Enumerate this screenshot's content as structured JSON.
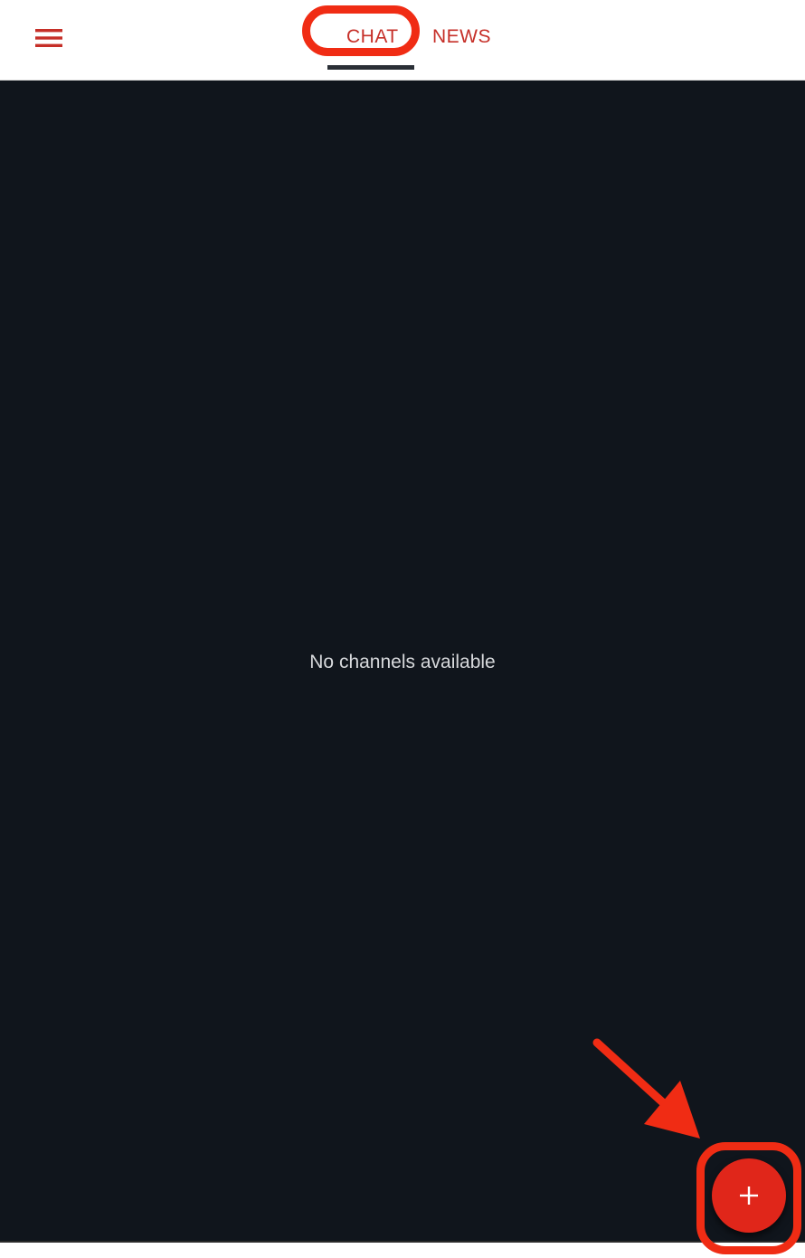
{
  "header": {
    "tabs": [
      {
        "label": "CHAT",
        "active": true
      },
      {
        "label": "NEWS",
        "active": false
      }
    ],
    "menu_icon": "hamburger-menu-icon"
  },
  "main": {
    "empty_message": "No channels available"
  },
  "fab": {
    "icon": "plus-icon"
  },
  "colors": {
    "accent": "#c62f28",
    "background": "#10151c",
    "fab": "#e0261a",
    "annotation": "#f02c14"
  }
}
